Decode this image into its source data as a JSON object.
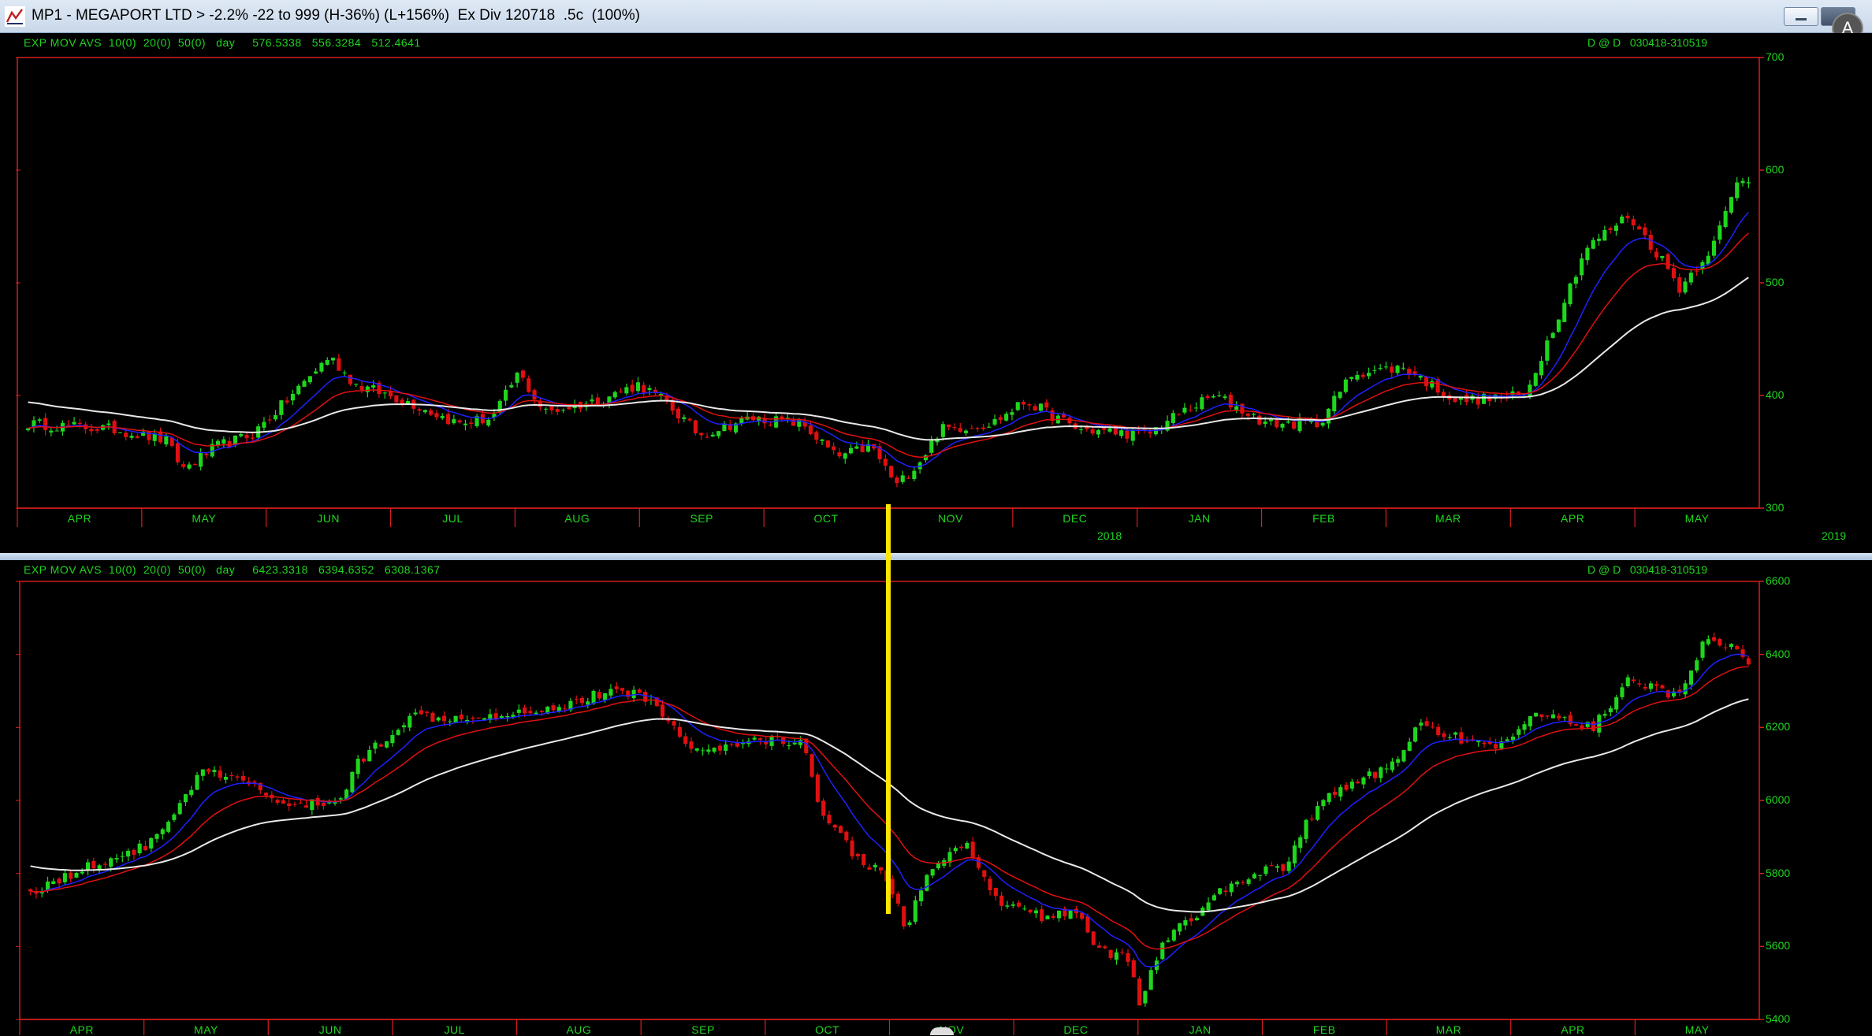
{
  "window": {
    "title": "MP1 - MEGAPORT LTD > -2.2% -22 to 999 (H-36%) (L+156%)  Ex Div 120718  .5c  (100%)"
  },
  "colors": {
    "background": "#000000",
    "text": "#1fd61f",
    "frame": "#d41f1f",
    "bull_candle": "#1fd61f",
    "bear_candle": "#e01010",
    "ema10": "#2020ff",
    "ema20": "#e01010",
    "ema50": "#e8e8e8",
    "cursor": "#ffe400"
  },
  "icons": {
    "app": "chart-app-icon",
    "minimize": "minimize-icon",
    "maximize": "maximize-icon",
    "accessibility": "accessibility-icon"
  },
  "charts": [
    {
      "indicator_label": "EXP MOV AVS  10(0)  20(0)  50(0)   day     576.5338   556.3284   512.4641",
      "range_label": "D @ D   030418-310519",
      "y_ticks": [
        "700",
        "600",
        "500",
        "400",
        "300"
      ],
      "x_months": [
        "APR",
        "MAY",
        "JUN",
        "JUL",
        "AUG",
        "SEP",
        "OCT",
        "NOV",
        "DEC",
        "JAN",
        "FEB",
        "MAR",
        "APR",
        "MAY"
      ],
      "year_labels": [
        "2018",
        "2019"
      ]
    },
    {
      "indicator_label": "EXP MOV AVS  10(0)  20(0)  50(0)   day     6423.3318   6394.6352   6308.1367",
      "range_label": "D @ D   030418-310519",
      "y_ticks": [
        "6600",
        "6400",
        "6200",
        "6000",
        "5800",
        "5600",
        "5400"
      ],
      "x_months": [
        "APR",
        "MAY",
        "JUN",
        "JUL",
        "AUG",
        "SEP",
        "OCT",
        "NOV",
        "DEC",
        "JAN",
        "FEB",
        "MAR",
        "APR",
        "MAY"
      ]
    }
  ],
  "chart_data": [
    {
      "type": "candlestick",
      "title": "MP1 - MEGAPORT LTD",
      "series": [
        {
          "name": "EXP MOV AVS 10(0)"
        },
        {
          "name": "EXP MOV AVS 20(0)"
        },
        {
          "name": "EXP MOV AVS 50(0)"
        }
      ],
      "ylim": [
        300,
        700
      ],
      "x_range": [
        "030418",
        "310519"
      ],
      "close_path": [
        [
          0,
          375
        ],
        [
          0.05,
          370
        ],
        [
          0.08,
          360
        ],
        [
          0.09,
          335
        ],
        [
          0.11,
          355
        ],
        [
          0.13,
          365
        ],
        [
          0.15,
          395
        ],
        [
          0.175,
          435
        ],
        [
          0.19,
          410
        ],
        [
          0.22,
          395
        ],
        [
          0.25,
          375
        ],
        [
          0.27,
          380
        ],
        [
          0.285,
          420
        ],
        [
          0.3,
          385
        ],
        [
          0.33,
          395
        ],
        [
          0.355,
          410
        ],
        [
          0.37,
          395
        ],
        [
          0.39,
          365
        ],
        [
          0.42,
          380
        ],
        [
          0.45,
          375
        ],
        [
          0.47,
          345
        ],
        [
          0.49,
          355
        ],
        [
          0.505,
          320
        ],
        [
          0.52,
          345
        ],
        [
          0.53,
          370
        ],
        [
          0.56,
          375
        ],
        [
          0.58,
          395
        ],
        [
          0.61,
          370
        ],
        [
          0.65,
          365
        ],
        [
          0.67,
          385
        ],
        [
          0.69,
          400
        ],
        [
          0.72,
          375
        ],
        [
          0.75,
          375
        ],
        [
          0.77,
          420
        ],
        [
          0.8,
          425
        ],
        [
          0.83,
          395
        ],
        [
          0.87,
          400
        ],
        [
          0.885,
          455
        ],
        [
          0.905,
          530
        ],
        [
          0.93,
          560
        ],
        [
          0.95,
          520
        ],
        [
          0.96,
          495
        ],
        [
          0.98,
          535
        ],
        [
          0.995,
          595
        ],
        [
          1.0,
          590
        ]
      ],
      "ema_last": {
        "EXP MOV AVS 10(0)": 576.5338,
        "EXP MOV AVS 20(0)": 556.3284,
        "EXP MOV AVS 50(0)": 512.4641
      }
    },
    {
      "type": "candlestick",
      "series": [
        {
          "name": "EXP MOV AVS 10(0)"
        },
        {
          "name": "EXP MOV AVS 20(0)"
        },
        {
          "name": "EXP MOV AVS 50(0)"
        }
      ],
      "ylim": [
        5400,
        6600
      ],
      "x_range": [
        "030418",
        "310519"
      ],
      "close_path": [
        [
          0,
          5750
        ],
        [
          0.04,
          5830
        ],
        [
          0.07,
          5880
        ],
        [
          0.1,
          6080
        ],
        [
          0.13,
          6040
        ],
        [
          0.15,
          5980
        ],
        [
          0.18,
          6000
        ],
        [
          0.19,
          6100
        ],
        [
          0.22,
          6230
        ],
        [
          0.25,
          6230
        ],
        [
          0.28,
          6240
        ],
        [
          0.31,
          6260
        ],
        [
          0.33,
          6290
        ],
        [
          0.355,
          6300
        ],
        [
          0.37,
          6220
        ],
        [
          0.39,
          6130
        ],
        [
          0.43,
          6170
        ],
        [
          0.45,
          6150
        ],
        [
          0.46,
          5980
        ],
        [
          0.48,
          5850
        ],
        [
          0.5,
          5780
        ],
        [
          0.51,
          5640
        ],
        [
          0.52,
          5790
        ],
        [
          0.545,
          5880
        ],
        [
          0.56,
          5730
        ],
        [
          0.59,
          5680
        ],
        [
          0.61,
          5700
        ],
        [
          0.62,
          5600
        ],
        [
          0.64,
          5560
        ],
        [
          0.645,
          5440
        ],
        [
          0.66,
          5620
        ],
        [
          0.68,
          5690
        ],
        [
          0.7,
          5780
        ],
        [
          0.73,
          5820
        ],
        [
          0.75,
          6000
        ],
        [
          0.79,
          6090
        ],
        [
          0.81,
          6210
        ],
        [
          0.85,
          6140
        ],
        [
          0.88,
          6240
        ],
        [
          0.91,
          6200
        ],
        [
          0.93,
          6330
        ],
        [
          0.96,
          6280
        ],
        [
          0.975,
          6460
        ],
        [
          0.99,
          6420
        ],
        [
          1.0,
          6360
        ]
      ],
      "ema_last": {
        "EXP MOV AVS 10(0)": 6423.3318,
        "EXP MOV AVS 20(0)": 6394.6352,
        "EXP MOV AVS 50(0)": 6308.1367
      }
    }
  ]
}
